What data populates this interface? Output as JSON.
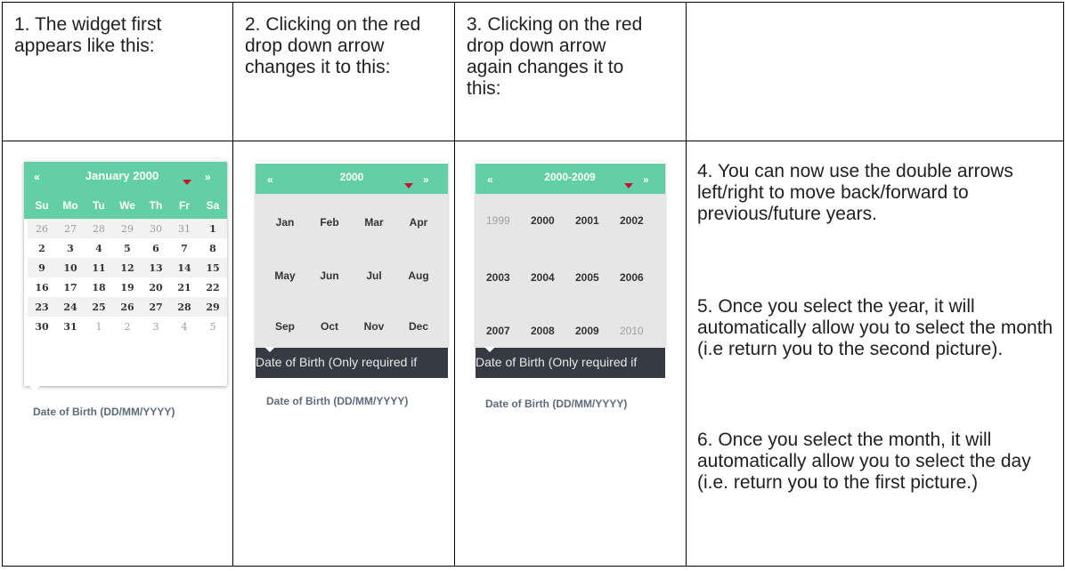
{
  "headers": [
    "1. The widget first appears like this:",
    "2. Clicking on the red drop down arrow changes it to this:",
    "3. Clicking on the red drop down arrow again changes it to this:",
    ""
  ],
  "day_view": {
    "prev": "«",
    "next": "»",
    "title": "January 2000",
    "weekdays": [
      "Su",
      "Mo",
      "Tu",
      "We",
      "Th",
      "Fr",
      "Sa"
    ],
    "weeks": [
      [
        "26",
        "27",
        "28",
        "29",
        "30",
        "31",
        "1"
      ],
      [
        "2",
        "3",
        "4",
        "5",
        "6",
        "7",
        "8"
      ],
      [
        "9",
        "10",
        "11",
        "12",
        "13",
        "14",
        "15"
      ],
      [
        "16",
        "17",
        "18",
        "19",
        "20",
        "21",
        "22"
      ],
      [
        "23",
        "24",
        "25",
        "26",
        "27",
        "28",
        "29"
      ],
      [
        "30",
        "31",
        "1",
        "2",
        "3",
        "4",
        "5"
      ]
    ],
    "field_label": "Date of Birth (DD/MM/YYYY)"
  },
  "month_view": {
    "prev": "«",
    "next": "»",
    "title": "2000",
    "months": [
      [
        "Jan",
        "Feb",
        "Mar",
        "Apr"
      ],
      [
        "May",
        "Jun",
        "Jul",
        "Aug"
      ],
      [
        "Sep",
        "Oct",
        "Nov",
        "Dec"
      ]
    ],
    "dark_bar": "Date of Birth (Only required if",
    "field_label": "Date of Birth (DD/MM/YYYY)"
  },
  "year_view": {
    "prev": "«",
    "next": "»",
    "title": "2000-2009",
    "years": [
      [
        "1999",
        "2000",
        "2001",
        "2002"
      ],
      [
        "2003",
        "2004",
        "2005",
        "2006"
      ],
      [
        "2007",
        "2008",
        "2009",
        "2010"
      ]
    ],
    "dark_bar": "Date of Birth (Only required if",
    "field_label": "Date of Birth (DD/MM/YYYY)"
  },
  "notes": [
    "4. You can now use the double arrows left/right to move back/forward to previous/future years.",
    "5. Once you select the year, it will automatically allow you to select the month (i.e return you to the second picture).",
    "6. Once you select the month, it will automatically allow you to select the day (i.e. return you to the first picture.)"
  ],
  "colors": {
    "header_band": "#63cfa7",
    "dropdown_arrow": "#c8102e",
    "dark_bar": "#363a42"
  }
}
